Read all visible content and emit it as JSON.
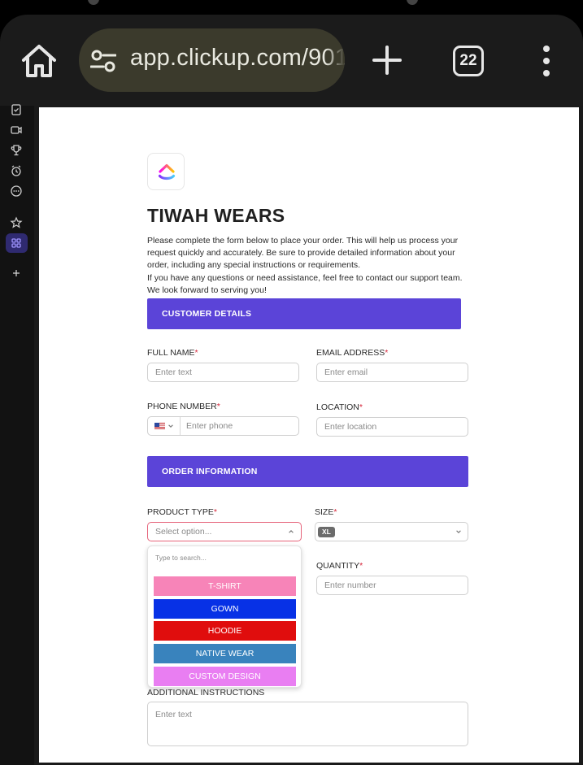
{
  "browser": {
    "url": "app.clickup.com/901",
    "tab_count": "22"
  },
  "form": {
    "title": "TIWAH WEARS",
    "description": [
      "Please complete the form below to place your order. This will help us process your request quickly and accurately. Be sure to provide detailed information about your order, including any special instructions or requirements.",
      "If you have any questions or need assistance, feel free to contact our support team. We look forward to serving you!"
    ],
    "sections": {
      "customer": "CUSTOMER DETAILS",
      "order": "ORDER INFORMATION"
    },
    "fields": {
      "full_name": {
        "label": "FULL NAME",
        "placeholder": "Enter text"
      },
      "email": {
        "label": "EMAIL ADDRESS",
        "placeholder": "Enter email"
      },
      "phone": {
        "label": "PHONE NUMBER",
        "placeholder": "Enter phone"
      },
      "location": {
        "label": "LOCATION",
        "placeholder": "Enter location"
      },
      "product_type": {
        "label": "PRODUCT TYPE",
        "placeholder": "Select option..."
      },
      "size": {
        "label": "SIZE",
        "value": "XL"
      },
      "quantity": {
        "label": "QUANTITY",
        "placeholder": "Enter number"
      },
      "instructions": {
        "label": "ADDITIONAL INSTRUCTIONS",
        "placeholder": "Enter text"
      }
    },
    "required_mark": "*",
    "dropdown": {
      "search_placeholder": "Type to search...",
      "options": [
        {
          "label": "T-SHIRT",
          "color": "#f784b8"
        },
        {
          "label": "GOWN",
          "color": "#0731e6"
        },
        {
          "label": "HOODIE",
          "color": "#e00d0d"
        },
        {
          "label": "NATIVE WEAR",
          "color": "#3983bd"
        },
        {
          "label": "CUSTOM DESIGN",
          "color": "#e97ef2"
        }
      ]
    }
  },
  "colors": {
    "accent": "#5b44d8",
    "required": "#d6263a"
  }
}
